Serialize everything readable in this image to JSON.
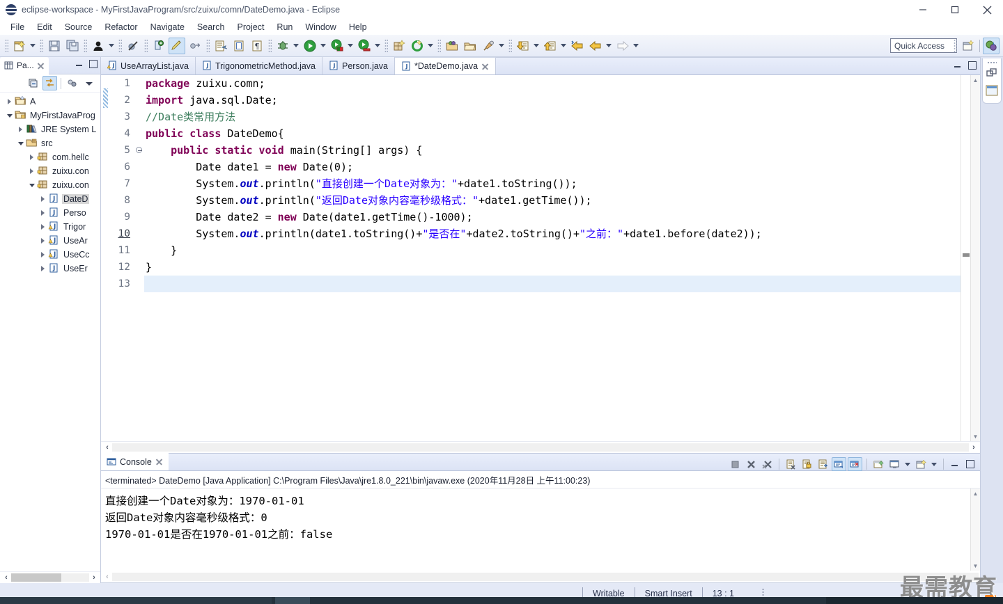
{
  "window": {
    "title": "eclipse-workspace - MyFirstJavaProgram/src/zuixu/comn/DateDemo.java - Eclipse",
    "minimize_label": "Minimize",
    "maximize_label": "Maximize",
    "close_label": "Close"
  },
  "menubar": {
    "items": [
      {
        "label": "File"
      },
      {
        "label": "Edit"
      },
      {
        "label": "Source"
      },
      {
        "label": "Refactor"
      },
      {
        "label": "Navigate"
      },
      {
        "label": "Search"
      },
      {
        "label": "Project"
      },
      {
        "label": "Run"
      },
      {
        "label": "Window"
      },
      {
        "label": "Help"
      }
    ]
  },
  "toolbar": {
    "quick_access_placeholder": "Quick Access",
    "buttons": [
      {
        "name": "new-wizard-icon",
        "label": "New"
      },
      {
        "name": "save-icon",
        "label": "Save"
      },
      {
        "name": "save-all-icon",
        "label": "Save All"
      },
      {
        "name": "user-icon",
        "label": "User"
      },
      {
        "name": "skip-breakpoints-icon",
        "label": "Skip All Breakpoints"
      },
      {
        "name": "new-class-icon",
        "label": "New Java Class"
      },
      {
        "name": "edit-highlight-icon",
        "label": "Toggle Mark Occurrences"
      },
      {
        "name": "link-icon",
        "label": "Open Type"
      },
      {
        "name": "external-tools-icon",
        "label": "External Tools"
      },
      {
        "name": "print-icon",
        "label": "Print"
      },
      {
        "name": "paragraph-icon",
        "label": "Show Whitespace"
      },
      {
        "name": "debug-icon",
        "label": "Debug"
      },
      {
        "name": "run-icon",
        "label": "Run"
      },
      {
        "name": "run-last-icon",
        "label": "Run Last Tool"
      },
      {
        "name": "coverage-icon",
        "label": "Coverage"
      },
      {
        "name": "new-package-icon",
        "label": "New Java Package"
      },
      {
        "name": "refresh-icon",
        "label": "Refresh"
      },
      {
        "name": "open-folder-icon",
        "label": "Open Resource"
      },
      {
        "name": "folder-icon",
        "label": "Open Folder"
      },
      {
        "name": "pin-icon",
        "label": "Pin"
      },
      {
        "name": "next-annotation-icon",
        "label": "Next Annotation"
      },
      {
        "name": "previous-annotation-icon",
        "label": "Previous Annotation"
      },
      {
        "name": "back-icon",
        "label": "Back"
      },
      {
        "name": "back-history-icon",
        "label": "Back History"
      },
      {
        "name": "forward-icon",
        "label": "Forward"
      }
    ],
    "perspective_new_label": "Open Perspective",
    "perspective_java_label": "Java"
  },
  "explorer": {
    "tab_label": "Pa...",
    "toolbar": [
      {
        "name": "collapse-all-icon",
        "label": "Collapse All"
      },
      {
        "name": "link-with-editor-icon",
        "label": "Link with Editor"
      },
      {
        "name": "view-menu-packages-icon",
        "label": "Package Presentation"
      },
      {
        "name": "view-menu-icon",
        "label": "View Menu"
      }
    ],
    "tree": [
      {
        "label": "A",
        "depth": 0,
        "twist": "closed",
        "icon": "project-icon",
        "selected": false
      },
      {
        "label": "MyFirstJavaProg",
        "depth": 0,
        "twist": "open",
        "icon": "java-project-icon",
        "selected": false
      },
      {
        "label": "JRE System L",
        "depth": 1,
        "twist": "closed",
        "icon": "library-icon",
        "selected": false
      },
      {
        "label": "src",
        "depth": 1,
        "twist": "open",
        "icon": "source-folder-icon",
        "selected": false
      },
      {
        "label": "com.hellc",
        "depth": 2,
        "twist": "closed",
        "icon": "package-icon",
        "selected": false
      },
      {
        "label": "zuixu.con",
        "depth": 2,
        "twist": "closed",
        "icon": "package-icon",
        "selected": false
      },
      {
        "label": "zuixu.con",
        "depth": 2,
        "twist": "open",
        "icon": "package-icon",
        "selected": false
      },
      {
        "label": "DateD",
        "depth": 3,
        "twist": "closed",
        "icon": "java-file-icon",
        "selected": true
      },
      {
        "label": "Perso",
        "depth": 3,
        "twist": "closed",
        "icon": "java-file-icon",
        "selected": false
      },
      {
        "label": "Trigor",
        "depth": 3,
        "twist": "closed",
        "icon": "java-file-warning-icon",
        "selected": false
      },
      {
        "label": "UseAr",
        "depth": 3,
        "twist": "closed",
        "icon": "java-file-warning-icon",
        "selected": false
      },
      {
        "label": "UseCc",
        "depth": 3,
        "twist": "closed",
        "icon": "java-file-warning-icon",
        "selected": false
      },
      {
        "label": "UseEr",
        "depth": 3,
        "twist": "closed",
        "icon": "java-file-icon",
        "selected": false
      }
    ]
  },
  "editor": {
    "tabs": [
      {
        "label": "UseArrayList.java",
        "active": false,
        "dirty": false,
        "warning": true
      },
      {
        "label": "TrigonometricMethod.java",
        "active": false,
        "dirty": false,
        "warning": false
      },
      {
        "label": "Person.java",
        "active": false,
        "dirty": false,
        "warning": false
      },
      {
        "label": "*DateDemo.java",
        "active": true,
        "dirty": true,
        "warning": false
      }
    ],
    "line_numbers": [
      "1",
      "2",
      "3",
      "4",
      "5",
      "6",
      "7",
      "8",
      "9",
      "10",
      "11",
      "12",
      "13"
    ],
    "current_line": "13",
    "code_lines": [
      {
        "n": 1,
        "segments": [
          {
            "t": "package ",
            "c": "kw"
          },
          {
            "t": "zuixu.comn;",
            "c": "plain"
          }
        ]
      },
      {
        "n": 2,
        "segments": [
          {
            "t": "import ",
            "c": "kw"
          },
          {
            "t": "java.sql.Date;",
            "c": "plain"
          }
        ]
      },
      {
        "n": 3,
        "segments": [
          {
            "t": "//Date类常用方法",
            "c": "cmt"
          }
        ]
      },
      {
        "n": 4,
        "segments": [
          {
            "t": "public class ",
            "c": "kw"
          },
          {
            "t": "DateDemo{",
            "c": "plain"
          }
        ]
      },
      {
        "n": 5,
        "segments": [
          {
            "t": "    ",
            "c": "plain"
          },
          {
            "t": "public static void ",
            "c": "kw"
          },
          {
            "t": "main(String[] args) {",
            "c": "plain"
          }
        ]
      },
      {
        "n": 6,
        "segments": [
          {
            "t": "        Date date1 = ",
            "c": "plain"
          },
          {
            "t": "new ",
            "c": "kw"
          },
          {
            "t": "Date(0);",
            "c": "plain"
          }
        ]
      },
      {
        "n": 7,
        "segments": [
          {
            "t": "        System.",
            "c": "plain"
          },
          {
            "t": "out",
            "c": "fld"
          },
          {
            "t": ".println(",
            "c": "plain"
          },
          {
            "t": "\"直接创建一个Date对象为：\"",
            "c": "str"
          },
          {
            "t": "+date1.toString());",
            "c": "plain"
          }
        ]
      },
      {
        "n": 8,
        "segments": [
          {
            "t": "        System.",
            "c": "plain"
          },
          {
            "t": "out",
            "c": "fld"
          },
          {
            "t": ".println(",
            "c": "plain"
          },
          {
            "t": "\"返回Date对象内容毫秒级格式：\"",
            "c": "str"
          },
          {
            "t": "+date1.getTime());",
            "c": "plain"
          }
        ]
      },
      {
        "n": 9,
        "segments": [
          {
            "t": "        Date date2 = ",
            "c": "plain"
          },
          {
            "t": "new ",
            "c": "kw"
          },
          {
            "t": "Date(date1.getTime()-1000);",
            "c": "plain"
          }
        ]
      },
      {
        "n": 10,
        "segments": [
          {
            "t": "        System.",
            "c": "plain"
          },
          {
            "t": "out",
            "c": "fld"
          },
          {
            "t": ".println(date1.toString()+",
            "c": "plain"
          },
          {
            "t": "\"是否在\"",
            "c": "str"
          },
          {
            "t": "+date2.toString()+",
            "c": "plain"
          },
          {
            "t": "\"之前：\"",
            "c": "str"
          },
          {
            "t": "+date1.before(date2));",
            "c": "plain"
          }
        ]
      },
      {
        "n": 11,
        "segments": [
          {
            "t": "    }",
            "c": "plain"
          }
        ]
      },
      {
        "n": 12,
        "segments": [
          {
            "t": "}",
            "c": "plain"
          }
        ]
      },
      {
        "n": 13,
        "segments": [
          {
            "t": "",
            "c": "plain"
          }
        ]
      }
    ]
  },
  "console": {
    "tab_label": "Console",
    "process_line": "<terminated> DateDemo [Java Application] C:\\Program Files\\Java\\jre1.8.0_221\\bin\\javaw.exe (2020年11月28日 上午11:00:23)",
    "output_lines": [
      "直接创建一个Date对象为：1970-01-01",
      "返回Date对象内容毫秒级格式：0",
      "1970-01-01是否在1970-01-01之前：false"
    ],
    "tools": [
      {
        "name": "terminate-icon",
        "label": "Terminate"
      },
      {
        "name": "remove-launch-icon",
        "label": "Remove Launch"
      },
      {
        "name": "remove-all-launches-icon",
        "label": "Remove All Terminated Launches"
      },
      {
        "name": "clear-console-icon",
        "label": "Clear Console"
      },
      {
        "name": "scroll-lock-icon",
        "label": "Scroll Lock"
      },
      {
        "name": "word-wrap-icon",
        "label": "Word Wrap"
      },
      {
        "name": "show-console-on-output-icon",
        "label": "Show Console When Standard Out Changes"
      },
      {
        "name": "show-console-on-error-icon",
        "label": "Show Console When Standard Error Changes"
      },
      {
        "name": "pin-console-icon",
        "label": "Pin Console"
      },
      {
        "name": "display-selected-console-icon",
        "label": "Display Selected Console"
      },
      {
        "name": "open-console-icon",
        "label": "Open Console"
      },
      {
        "name": "minimize-icon",
        "label": "Minimize"
      },
      {
        "name": "maximize-icon",
        "label": "Maximize"
      }
    ]
  },
  "right_rail": {
    "items": [
      {
        "name": "restore-perspective-icon",
        "label": "Restore"
      },
      {
        "name": "package-explorer-rail-icon",
        "label": "Package Explorer"
      }
    ]
  },
  "statusbar": {
    "writable": "Writable",
    "insert_mode": "Smart Insert",
    "position": "13 : 1"
  },
  "watermark": {
    "text": "最需教育"
  },
  "colors": {
    "accent": "#cfe3f7",
    "selection": "#e4effb",
    "keyword": "#7f0055",
    "string": "#2a00ff",
    "comment": "#3f7f5f",
    "field": "#0000c0",
    "chrome": "#e3e8f6"
  }
}
